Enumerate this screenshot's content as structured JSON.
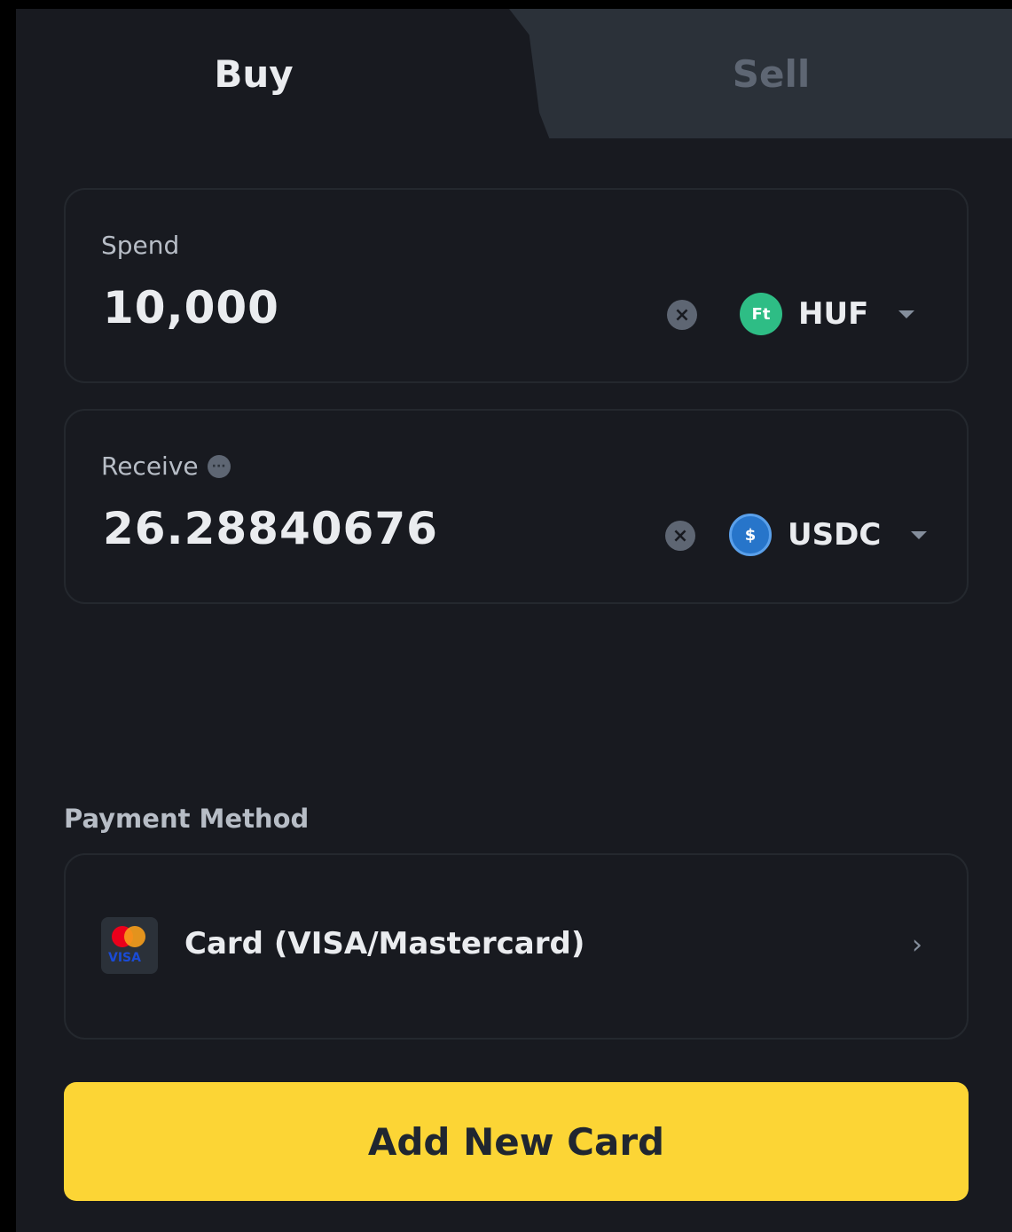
{
  "tabs": {
    "buy_label": "Buy",
    "sell_label": "Sell",
    "active": "Buy"
  },
  "spend": {
    "label": "Spend",
    "value": "10,000",
    "currency_code": "HUF",
    "currency_icon_text": "Ft",
    "currency_icon_color": "#2ebd85"
  },
  "receive": {
    "label": "Receive",
    "value": "26.28840676",
    "currency_code": "USDC",
    "currency_icon_text": "$",
    "currency_icon_color": "#2775ca"
  },
  "payment": {
    "section_label": "Payment Method",
    "method_label": "Card (VISA/Mastercard)",
    "card_brand_text": "VISA"
  },
  "actions": {
    "add_card_label": "Add New Card"
  },
  "colors": {
    "background": "#181a20",
    "accent": "#fcd535",
    "text_primary": "#eaecef",
    "text_muted": "#5e6673"
  }
}
